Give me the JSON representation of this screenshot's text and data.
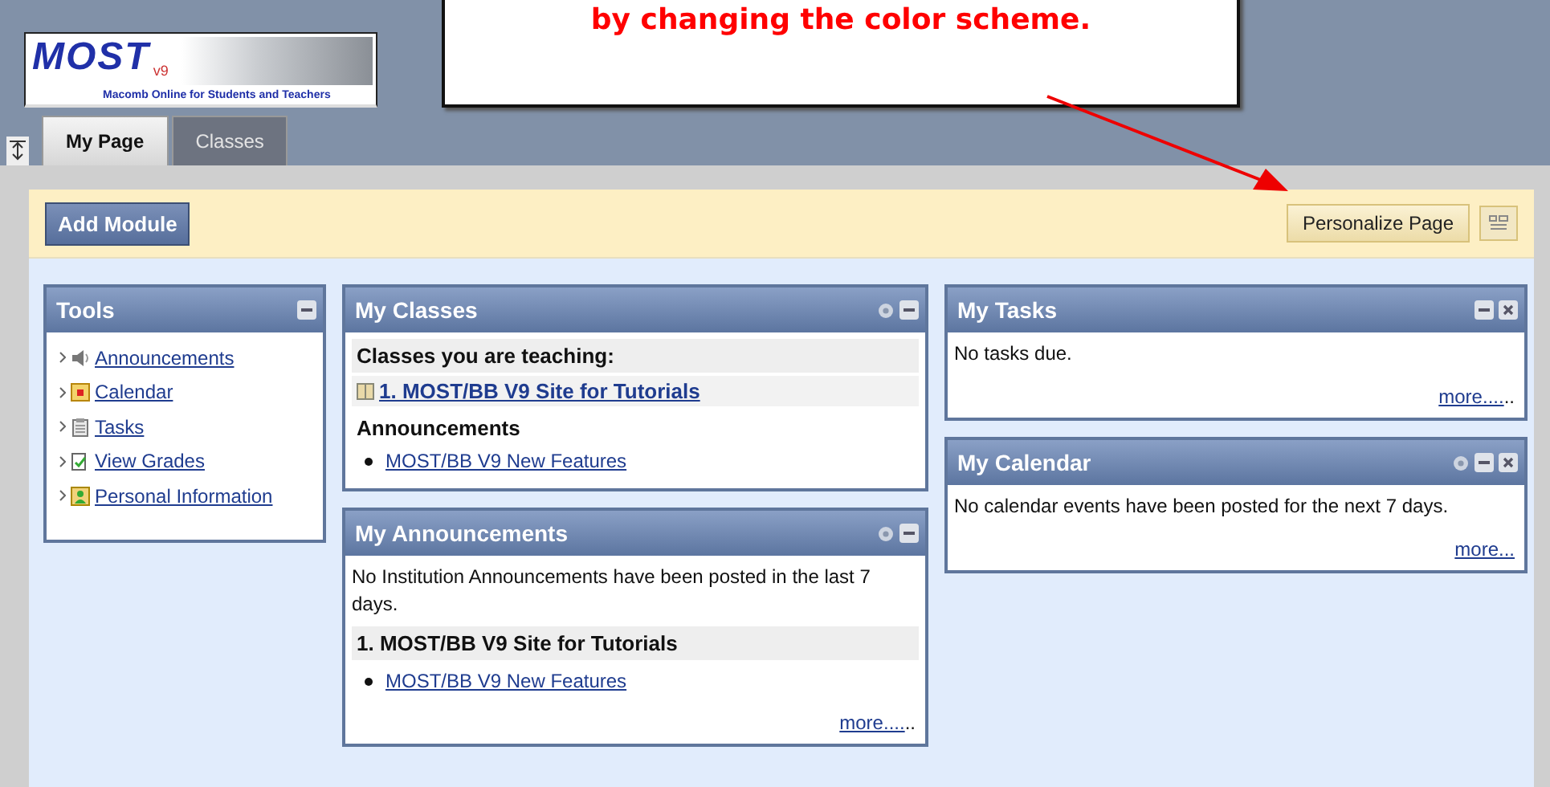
{
  "callout": {
    "text": "by changing the color scheme."
  },
  "logo": {
    "wordmark": "MOST",
    "version": "v9",
    "tagline": "Macomb Online for Students and Teachers"
  },
  "tabs": [
    {
      "label": "My Page",
      "selected": true
    },
    {
      "label": "Classes",
      "selected": false
    }
  ],
  "toolbar": {
    "add_button": "Add Module",
    "personalize_button": "Personalize Page"
  },
  "columns": [
    [
      {
        "title": "Tools",
        "gear": false,
        "minimize": true,
        "close": false,
        "blocks": [
          {
            "kind": "tools",
            "items": [
              {
                "label": "Announcements",
                "kind": "speaker"
              },
              {
                "label": "Calendar",
                "kind": "calendar"
              },
              {
                "label": "Tasks",
                "kind": "clipboard"
              },
              {
                "label": "View Grades",
                "kind": "grades"
              },
              {
                "label": "Personal Information",
                "kind": "contact"
              }
            ]
          }
        ]
      }
    ],
    [
      {
        "title": "My Classes",
        "gear": true,
        "minimize": true,
        "close": false,
        "blocks": [
          {
            "kind": "heading",
            "text": "Classes you are teaching:"
          },
          {
            "kind": "course",
            "text": "1. MOST/BB V9 Site for Tutorials"
          },
          {
            "kind": "subheading",
            "text": "Announcements"
          },
          {
            "kind": "bullet",
            "text": "MOST/BB V9 New Features"
          }
        ]
      },
      {
        "title": "My Announcements",
        "gear": true,
        "minimize": true,
        "close": false,
        "blocks": [
          {
            "kind": "text",
            "text": "No Institution Announcements have been posted in the last 7 days."
          },
          {
            "kind": "heading",
            "text": "1. MOST/BB V9 Site for Tutorials"
          },
          {
            "kind": "bullet",
            "text": "MOST/BB V9 New Features"
          },
          {
            "kind": "more",
            "text": "more....",
            "trail": ".."
          }
        ]
      }
    ],
    [
      {
        "title": "My Tasks",
        "gear": false,
        "minimize": true,
        "close": true,
        "blocks": [
          {
            "kind": "text",
            "text": "No tasks due."
          },
          {
            "kind": "more",
            "text": "more....",
            "trail": ".."
          }
        ]
      },
      {
        "title": "My Calendar",
        "gear": true,
        "minimize": true,
        "close": true,
        "blocks": [
          {
            "kind": "text",
            "text": "No calendar events have been posted for the next 7 days."
          },
          {
            "kind": "more",
            "text": "more..."
          }
        ]
      }
    ]
  ]
}
